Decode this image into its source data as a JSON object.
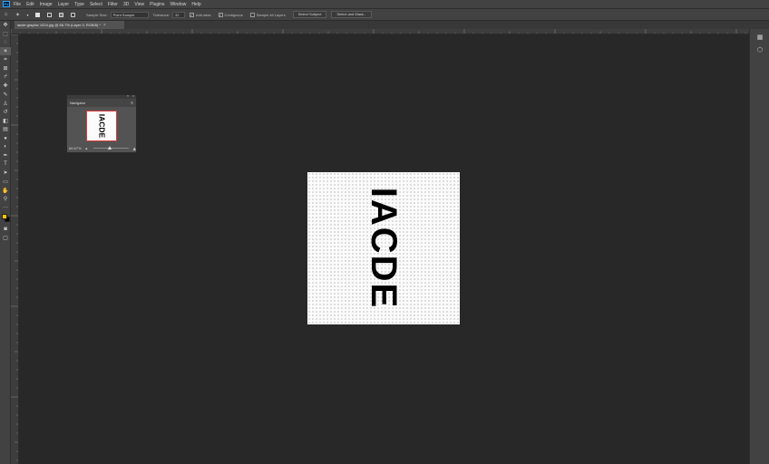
{
  "menubar": {
    "logo": "Ps",
    "items": [
      "File",
      "Edit",
      "Image",
      "Layer",
      "Type",
      "Select",
      "Filter",
      "3D",
      "View",
      "Plugins",
      "Window",
      "Help"
    ]
  },
  "options": {
    "sample_size_label": "Sample Size:",
    "sample_size_value": "Point Sample",
    "tolerance_label": "Tolerance:",
    "tolerance_value": "32",
    "antialias_label": "Anti-alias",
    "contiguous_label": "Contiguous",
    "sample_all_layers_label": "Sample All Layers",
    "select_subject_label": "Select Subject",
    "select_mask_label": "Select and Mask..."
  },
  "document_tab": {
    "title": "iacde graphic 1024.jpg @ 66.7% (Layer 0, RGB/8) *",
    "close": "×"
  },
  "canvas": {
    "text": "IACDE"
  },
  "navigator": {
    "title": "Navigator",
    "zoom": "66.67%",
    "thumb_text": "IACDE",
    "slider_position": 0.45
  },
  "colors": {
    "foreground": "#f5c400",
    "background": "#000000"
  },
  "icons": {
    "home": "home-icon",
    "magic_wand": "magic-wand-icon"
  }
}
